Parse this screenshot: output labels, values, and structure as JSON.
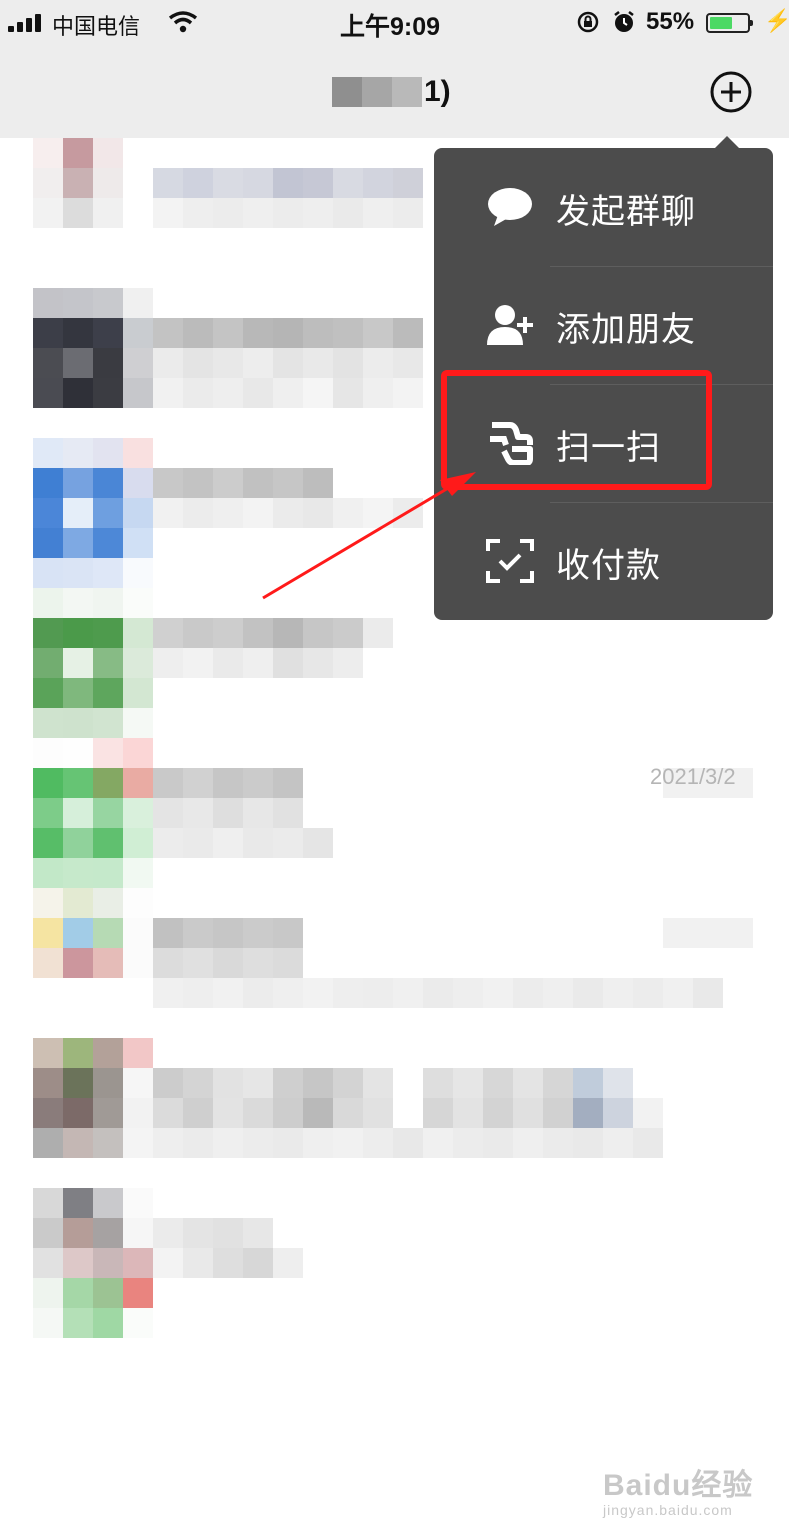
{
  "status_bar": {
    "carrier": "中国电信",
    "time": "上午9:09",
    "battery_percent": "55%",
    "battery_level": 0.55
  },
  "nav": {
    "title_visible": "1)",
    "add_icon": "plus-circle-icon"
  },
  "popup_menu": {
    "items": [
      {
        "label": "发起群聊",
        "icon": "chat-bubble-icon"
      },
      {
        "label": "添加朋友",
        "icon": "add-friend-icon"
      },
      {
        "label": "扫一扫",
        "icon": "scan-icon"
      },
      {
        "label": "收付款",
        "icon": "payment-icon"
      }
    ]
  },
  "chat_list": {
    "visible_date": "2021/3/2"
  },
  "annotation": {
    "highlight_color": "#ff1a1a",
    "highlighted_item": "扫一扫"
  },
  "watermark": {
    "brand": "Baidu经验",
    "url": "jingyan.baidu.com"
  }
}
